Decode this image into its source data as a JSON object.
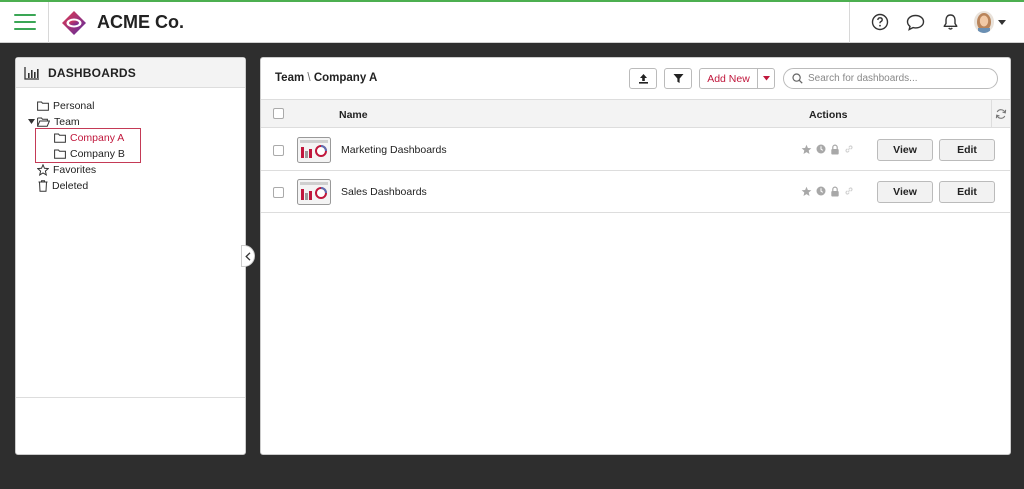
{
  "header": {
    "brand": "ACME Co.",
    "accent_color": "#3aa655",
    "icons": [
      "menu-icon",
      "help-icon",
      "chat-icon",
      "bell-icon",
      "avatar"
    ]
  },
  "sidebar": {
    "title": "DASHBOARDS",
    "items": [
      {
        "label": "Personal",
        "icon": "folder-icon"
      },
      {
        "label": "Team",
        "icon": "folder-open-icon",
        "expanded": true
      },
      {
        "label": "Company A",
        "icon": "folder-icon",
        "selected": true
      },
      {
        "label": "Company B",
        "icon": "folder-icon"
      },
      {
        "label": "Favorites",
        "icon": "star-icon"
      },
      {
        "label": "Deleted",
        "icon": "trash-icon"
      }
    ],
    "selected_color": "#c0173c"
  },
  "main": {
    "breadcrumb": {
      "parent": "Team",
      "separator": "\\",
      "current": "Company A"
    },
    "add_new_label": "Add New",
    "search_placeholder": "Search for dashboards...",
    "columns": {
      "name": "Name",
      "actions": "Actions"
    },
    "rows": [
      {
        "name": "Marketing Dashboards",
        "view": "View",
        "edit": "Edit"
      },
      {
        "name": "Sales Dashboards",
        "view": "View",
        "edit": "Edit"
      }
    ]
  }
}
